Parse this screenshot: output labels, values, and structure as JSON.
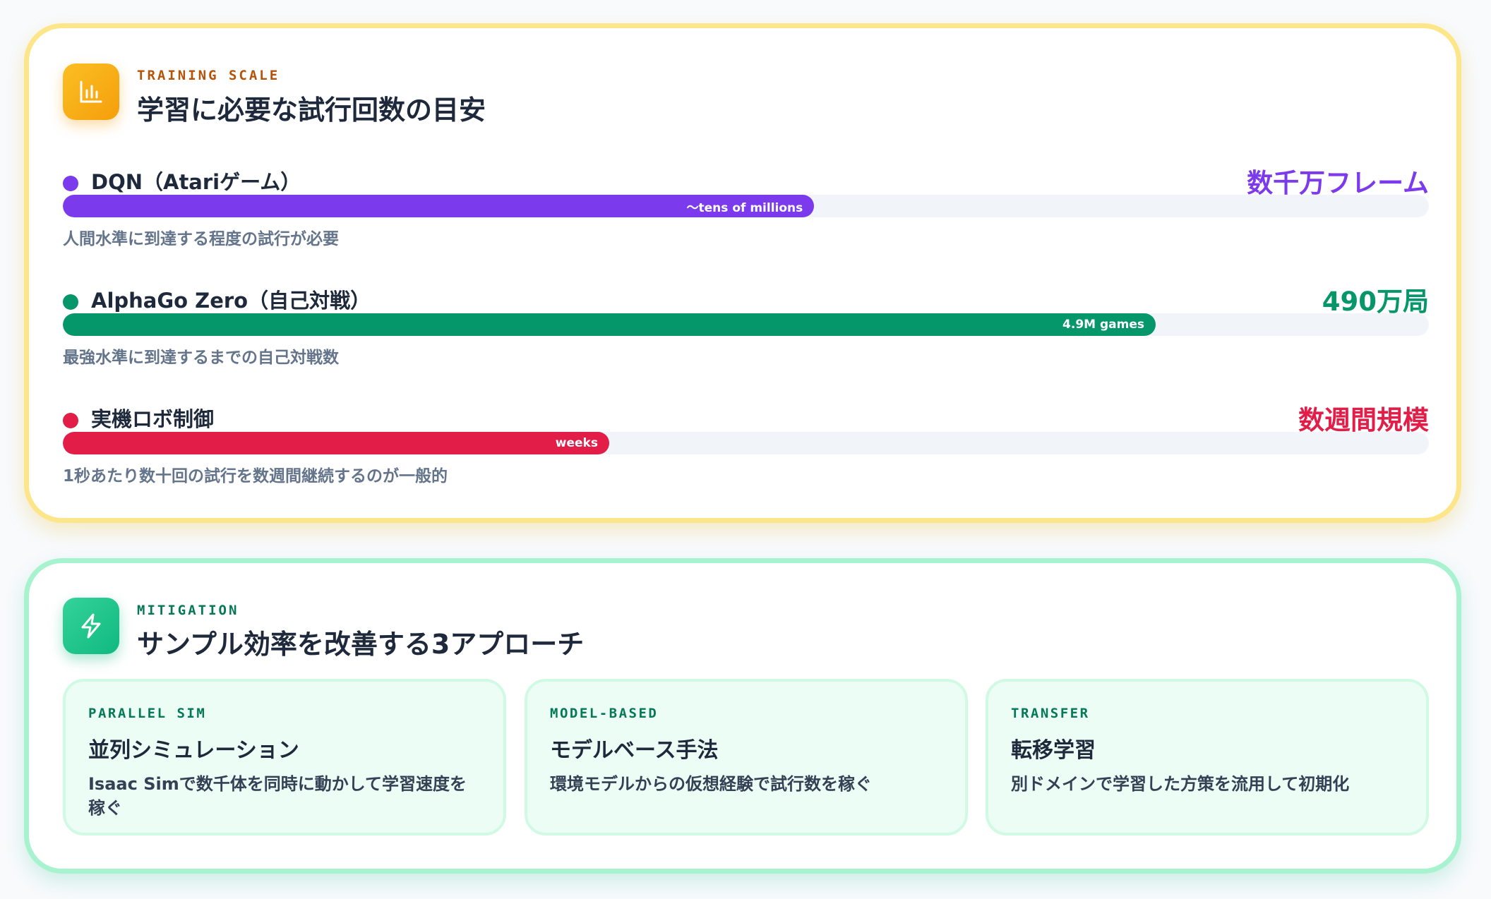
{
  "training_scale": {
    "eyebrow": "TRAINING SCALE",
    "title": "学習に必要な試行回数の目安",
    "icon": "bar-chart-icon",
    "metrics": [
      {
        "label": "DQN（Atariゲーム）",
        "value": "数千万フレーム",
        "bar_label": "～tens of millions",
        "description": "人間水準に到達する程度の試行が必要",
        "color": "#7c3aed",
        "fill_percent": 55
      },
      {
        "label": "AlphaGo Zero（自己対戦）",
        "value": "490万局",
        "bar_label": "4.9M games",
        "description": "最強水準に到達するまでの自己対戦数",
        "color": "#059669",
        "fill_percent": 80
      },
      {
        "label": "実機ロボ制御",
        "value": "数週間規模",
        "bar_label": "weeks",
        "description": "1秒あたり数十回の試行を数週間継続するのが一般的",
        "color": "#e11d48",
        "fill_percent": 40
      }
    ]
  },
  "mitigation": {
    "eyebrow": "MITIGATION",
    "title": "サンプル効率を改善する3アプローチ",
    "icon": "lightning-bolt-icon",
    "approaches": [
      {
        "tag": "PARALLEL SIM",
        "title": "並列シミュレーション",
        "description": "Isaac Simで数千体を同時に動かして学習速度を稼ぐ"
      },
      {
        "tag": "MODEL-BASED",
        "title": "モデルベース手法",
        "description": "環境モデルからの仮想経験で試行数を稼ぐ"
      },
      {
        "tag": "TRANSFER",
        "title": "転移学習",
        "description": "別ドメインで学習した方策を流用して初期化"
      }
    ]
  }
}
